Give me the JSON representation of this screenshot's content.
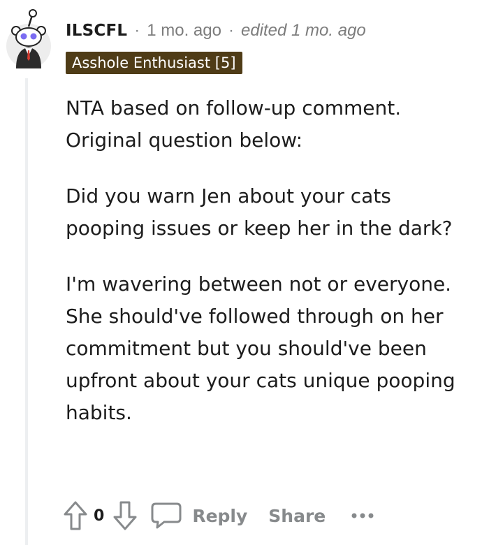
{
  "comment": {
    "username": "ILSCFL",
    "separator": "·",
    "time": "1 mo. ago",
    "edited": "edited 1 mo. ago",
    "flair": "Asshole Enthusiast [5]",
    "paragraphs": [
      "NTA based on follow-up comment. Original question below:",
      "Did you warn Jen about your cats pooping issues or keep her in the dark?",
      "I'm wavering between not or everyone. She should've followed through on her commitment but you should've been upfront about your cats unique pooping habits."
    ],
    "actions": {
      "score": "0",
      "reply_label": "Reply",
      "share_label": "Share",
      "more_label": "•••"
    }
  },
  "icons": {
    "avatar": "reddit-snoo-avatar-icon",
    "upvote": "arrow-up-icon",
    "downvote": "arrow-down-icon",
    "reply": "speech-bubble-icon",
    "more": "ellipsis-icon"
  },
  "colors": {
    "flair_background": "#4f3c17",
    "flair_text": "#ffffff",
    "meta_text": "#7c7c7c",
    "action_text": "#878a8c",
    "body_text": "#1c1c1c",
    "thread_line": "#edeff1"
  }
}
